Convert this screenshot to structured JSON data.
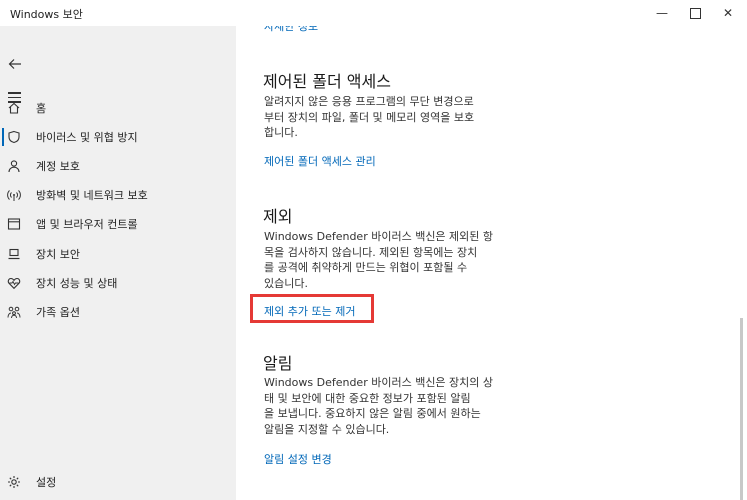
{
  "window": {
    "title": "Windows 보안",
    "controls": {
      "minimize": "—",
      "maximize": "",
      "close": "✕"
    }
  },
  "sidebar": {
    "items": [
      {
        "label": "홈",
        "icon": "home-icon"
      },
      {
        "label": "바이러스 및 위협 방지",
        "icon": "shield-icon",
        "active": true
      },
      {
        "label": "계정 보호",
        "icon": "person-icon"
      },
      {
        "label": "방화벽 및 네트워크 보호",
        "icon": "wifi-antenna-icon"
      },
      {
        "label": "앱 및 브라우저 컨트롤",
        "icon": "app-window-icon"
      },
      {
        "label": "장치 보안",
        "icon": "laptop-icon"
      },
      {
        "label": "장치 성능 및 상태",
        "icon": "heart-pulse-icon"
      },
      {
        "label": "가족 옵션",
        "icon": "family-icon"
      }
    ],
    "settings_label": "설정"
  },
  "main": {
    "top_link": "자세한 정보",
    "controlled_folder": {
      "title": "제어된 폴더 액세스",
      "desc_lines": [
        "알려지지 않은 응용 프로그램의 무단 변경으로",
        "부터 장치의 파일, 폴더 및 메모리 영역을 보호",
        "합니다."
      ],
      "link": "제어된 폴더 액세스 관리"
    },
    "exclusions": {
      "title": "제외",
      "desc_lines": [
        "Windows Defender 바이러스 백신은 제외된 항",
        "목을 검사하지 않습니다. 제외된 항목에는 장치",
        "를 공격에 취약하게 만드는 위협이 포함될 수",
        "있습니다."
      ],
      "link": "제외 추가 또는 제거"
    },
    "notifications": {
      "title": "알림",
      "desc_lines": [
        "Windows Defender 바이러스 백신은 장치의 상",
        "태 및 보안에 대한 중요한 정보가 포함된 알림",
        "을 보냅니다. 중요하지 않은 알림 중에서 원하는",
        "알림을 지정할 수 있습니다."
      ],
      "link": "알림 설정 변경"
    }
  },
  "colors": {
    "accent": "#0067b8",
    "highlight_box": "#e53935",
    "sidebar_bg": "#f0f0f0"
  }
}
